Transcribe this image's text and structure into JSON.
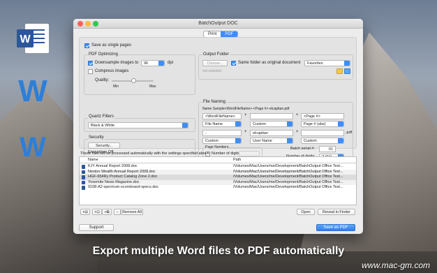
{
  "window": {
    "title": "BatchOutput DOC"
  },
  "tabs": [
    "Print",
    "PDF"
  ],
  "options": {
    "save_single": "Save as single pages"
  },
  "pdf_opt": {
    "group": "PDF Optimizing",
    "downsample": "Downsample images to",
    "dpi_value": "96",
    "dpi_unit": "dpi",
    "compress": "Compress images",
    "quality": "Quality:",
    "min": "Min",
    "max": "Max"
  },
  "quartz": {
    "group": "Quartz Filters",
    "value": "Black & White"
  },
  "security": {
    "group": "Security",
    "button": "Security...",
    "encryption": "Encryption: Off"
  },
  "output": {
    "group": "Output Folder",
    "choose": "Choose...",
    "same_folder": "Same folder as original document",
    "favorites": "Favorites",
    "not_selected": "not selected"
  },
  "naming": {
    "group": "File Naming",
    "sample_label": "Name Sample:",
    "sample": "<WordFileName>-<Page #>-elcapitan.pdf",
    "r1": [
      "<WordFileName>",
      "",
      "<Page #>"
    ],
    "r2": [
      "File Name",
      "Custom",
      "Page # (abs)"
    ],
    "r3": [
      "-",
      "elcapitan",
      ""
    ],
    "r4": [
      "Custom",
      "User Name",
      "Custom"
    ],
    "plus": "+",
    "ext": ".pdf",
    "page_numbers": "Page Numbers",
    "num_digits_cb": "Number of digits:",
    "batch_serial_label": "Batch serial #:",
    "batch_serial": "01",
    "digits_label": "Number of digits:",
    "digits": "2 (01)"
  },
  "files": {
    "info": "These files will be processed automatically with the settings specified above:",
    "col_name": "Name",
    "col_path": "Path",
    "rows": [
      {
        "name": "KJY Annual Report 2008.doc",
        "path": "/Volumes/Mac/Users/me/Development/BatchOutput Office Test..."
      },
      {
        "name": "Neston Wealth Annual Report 2008.doc",
        "path": "/Volumes/Mac/Users/me/Development/BatchOutput Office Test..."
      },
      {
        "name": "HGF-654Ry Product Catalog Zone 2.doc",
        "path": "/Volumes/Mac/Users/me/Development/BatchOutput Office Test..."
      },
      {
        "name": "Yosemite News Magazine.doc",
        "path": "/Volumes/Mac/Users/me/Development/BatchOutput Office Test..."
      },
      {
        "name": "9108-A2-spectrum-scoreboard-specs.doc",
        "path": "/Volumes/Mac/Users/me/Development/BatchOutput Office Test..."
      }
    ]
  },
  "bottom": {
    "add1": "+⊟",
    "add2": "+⊡",
    "add3": "+⧉",
    "minus": "−",
    "remove_all": "Remove All",
    "open": "Open",
    "reveal": "Reveal in Finder",
    "support": "Support",
    "save_pdf": "Save as PDF"
  },
  "caption": "Export multiple Word files to PDF automatically",
  "watermark": "www.mac-gm.com",
  "colors": {
    "accent": "#3d8ef5",
    "word_blue": "#2b579a"
  }
}
